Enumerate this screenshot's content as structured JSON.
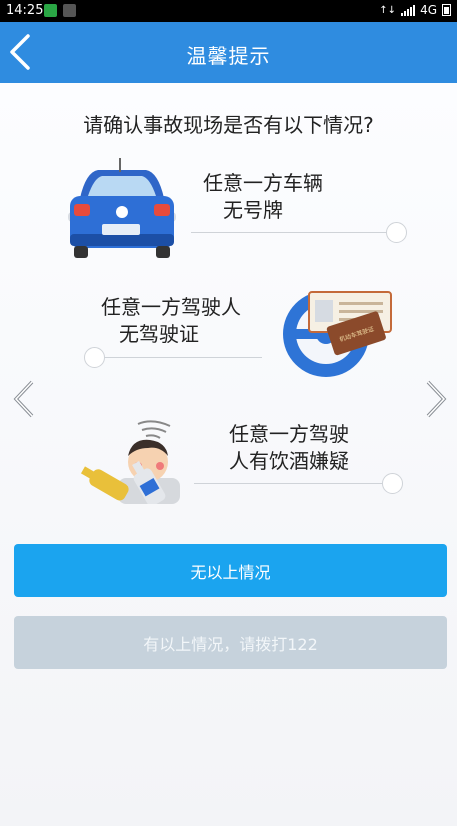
{
  "status_bar": {
    "time": "14:25",
    "network": "4G",
    "signal_text": "↑↓",
    "notification_icons": [
      "wechat-icon",
      "gallery-icon"
    ]
  },
  "header": {
    "title": "温馨提示",
    "back_icon": "chevron-left-icon"
  },
  "main": {
    "question": "请确认事故现场是否有以下情况?",
    "items": [
      {
        "line1": "任意一方车辆",
        "line2": "无号牌",
        "illustration": "car-icon"
      },
      {
        "line1": "任意一方驾驶人",
        "line2": "无驾驶证",
        "illustration": "license-icon"
      },
      {
        "line1": "任意一方驾驶",
        "line2": "人有饮酒嫌疑",
        "illustration": "drunk-icon"
      }
    ],
    "license_card_text": "机动车驾驶证"
  },
  "buttons": {
    "none_label": "无以上情况",
    "has_label": "有以上情况，请拨打122"
  },
  "colors": {
    "header_bg": "#2f8ce0",
    "primary_button": "#1ba4ef",
    "secondary_button": "#c6d2dc"
  }
}
